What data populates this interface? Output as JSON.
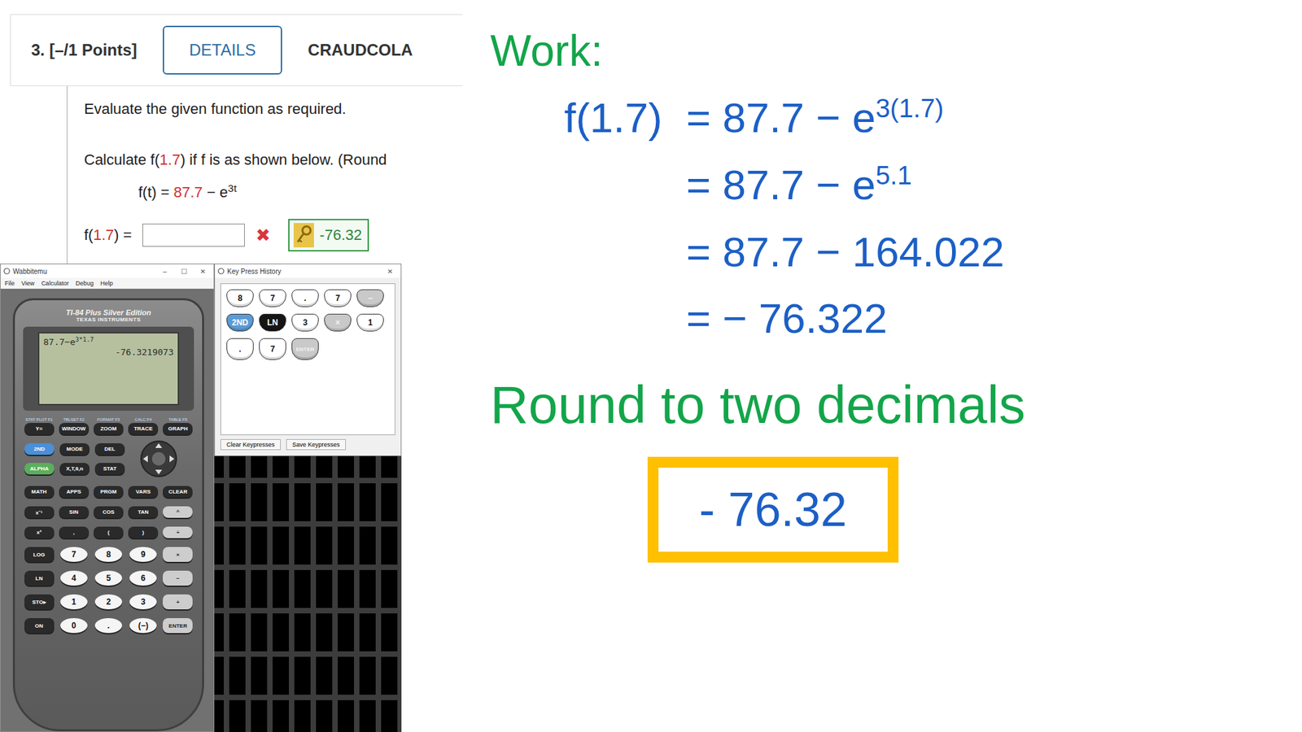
{
  "question": {
    "number": "3.",
    "points": "[–/1 Points]",
    "details_button": "DETAILS",
    "source": "CRAUDCOLA",
    "instruction": "Evaluate the given function as required.",
    "prompt": {
      "before": "Calculate f(",
      "value": "1.7",
      "after": ") if f is as shown below. (Round"
    },
    "function": {
      "lhs": "f(t) = ",
      "constant": "87.7",
      "rest": " − e",
      "exponent": "3t"
    },
    "answer": {
      "before": "f(",
      "value": "1.7",
      "after": ") =",
      "input": "",
      "correct": false,
      "mark": "✖",
      "key_answer": "-76.32"
    }
  },
  "emulator": {
    "title": "Wabbitemu",
    "controls": [
      "–",
      "☐",
      "✕"
    ],
    "menu": [
      "File",
      "View",
      "Calculator",
      "Debug",
      "Help"
    ],
    "model": "TI-84 Plus Silver Edition",
    "brand": "TEXAS INSTRUMENTS",
    "screen": {
      "expression": "87.7−e",
      "exponent": "3*1.7",
      "result": "-76.3219073"
    },
    "function_keys": [
      {
        "label": "Y=",
        "above": "STAT PLOT F1"
      },
      {
        "label": "WINDOW",
        "above": "TBLSET F2"
      },
      {
        "label": "ZOOM",
        "above": "FORMAT F3"
      },
      {
        "label": "TRACE",
        "above": "CALC F4"
      },
      {
        "label": "GRAPH",
        "above": "TABLE F5"
      }
    ],
    "top_keys": [
      {
        "label": "2ND",
        "kind": "blue"
      },
      {
        "label": "MODE",
        "kind": "dark"
      },
      {
        "label": "DEL",
        "kind": "dark"
      },
      {
        "label": "ALPHA",
        "kind": "green"
      },
      {
        "label": "X,T,θ,n",
        "kind": "dark"
      },
      {
        "label": "STAT",
        "kind": "dark"
      }
    ],
    "keys": [
      {
        "label": "MATH",
        "kind": "dark"
      },
      {
        "label": "APPS",
        "kind": "dark"
      },
      {
        "label": "PRGM",
        "kind": "dark"
      },
      {
        "label": "VARS",
        "kind": "dark"
      },
      {
        "label": "CLEAR",
        "kind": "dark"
      },
      {
        "label": "x⁻¹",
        "kind": "dark"
      },
      {
        "label": "SIN",
        "kind": "dark"
      },
      {
        "label": "COS",
        "kind": "dark"
      },
      {
        "label": "TAN",
        "kind": "dark"
      },
      {
        "label": "^",
        "kind": "light"
      },
      {
        "label": "x²",
        "kind": "dark"
      },
      {
        "label": ",",
        "kind": "dark"
      },
      {
        "label": "(",
        "kind": "dark"
      },
      {
        "label": ")",
        "kind": "dark"
      },
      {
        "label": "÷",
        "kind": "light"
      },
      {
        "label": "LOG",
        "kind": "dark"
      },
      {
        "label": "7",
        "kind": "white"
      },
      {
        "label": "8",
        "kind": "white"
      },
      {
        "label": "9",
        "kind": "white"
      },
      {
        "label": "×",
        "kind": "light"
      },
      {
        "label": "LN",
        "kind": "dark"
      },
      {
        "label": "4",
        "kind": "white"
      },
      {
        "label": "5",
        "kind": "white"
      },
      {
        "label": "6",
        "kind": "white"
      },
      {
        "label": "−",
        "kind": "light"
      },
      {
        "label": "STO▸",
        "kind": "dark"
      },
      {
        "label": "1",
        "kind": "white"
      },
      {
        "label": "2",
        "kind": "white"
      },
      {
        "label": "3",
        "kind": "white"
      },
      {
        "label": "+",
        "kind": "light"
      },
      {
        "label": "ON",
        "kind": "dark"
      },
      {
        "label": "0",
        "kind": "white"
      },
      {
        "label": ".",
        "kind": "white"
      },
      {
        "label": "(−)",
        "kind": "white"
      },
      {
        "label": "ENTER",
        "kind": "light"
      }
    ]
  },
  "key_history": {
    "title": "Key Press History",
    "close": "✕",
    "keys": [
      {
        "label": "8",
        "kind": "white"
      },
      {
        "label": "7",
        "kind": "white"
      },
      {
        "label": ".",
        "kind": "white"
      },
      {
        "label": "7",
        "kind": "white"
      },
      {
        "label": "−",
        "kind": "light"
      },
      {
        "label": "2ND",
        "kind": "blue"
      },
      {
        "label": "LN",
        "kind": "dark"
      },
      {
        "label": "3",
        "kind": "white"
      },
      {
        "label": "×",
        "kind": "light"
      },
      {
        "label": "1",
        "kind": "white"
      },
      {
        "label": ".",
        "kind": "white"
      },
      {
        "label": "7",
        "kind": "white"
      },
      {
        "label": "ENTER",
        "kind": "light"
      }
    ],
    "buttons": [
      "Clear Keypresses",
      "Save Keypresses"
    ]
  },
  "work": {
    "heading": "Work:",
    "lines": [
      {
        "prefix": "f(1.7)",
        "expr": "= 87.7 − e",
        "exponent": "3(1.7)"
      },
      {
        "prefix": "",
        "expr": "= 87.7 − e",
        "exponent": "5.1"
      },
      {
        "prefix": "",
        "expr": "= 87.7 − 164.022",
        "exponent": ""
      },
      {
        "prefix": "",
        "expr": "= − 76.322",
        "exponent": ""
      }
    ],
    "note": "Round to two decimals",
    "answer": "- 76.32"
  }
}
